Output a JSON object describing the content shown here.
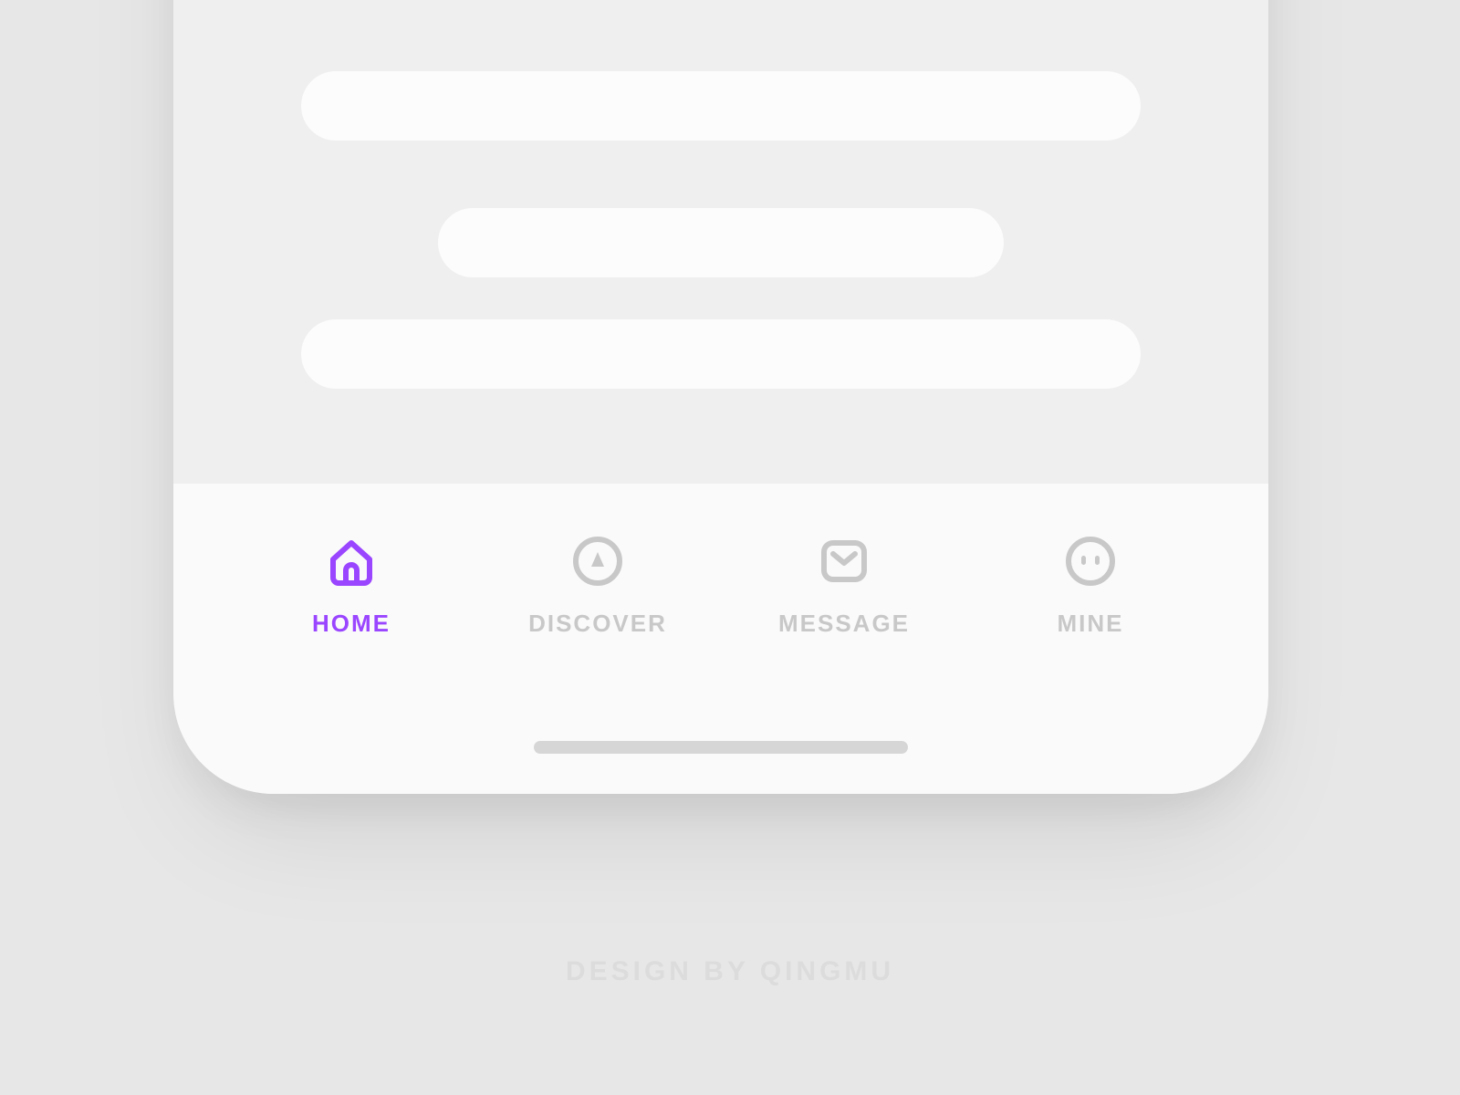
{
  "accent": "#9a45ff",
  "inactive": "#c8c8c8",
  "tabs": [
    {
      "label": "HOME",
      "icon": "home-icon",
      "active": true
    },
    {
      "label": "DISCOVER",
      "icon": "compass-icon",
      "active": false
    },
    {
      "label": "MESSAGE",
      "icon": "envelope-icon",
      "active": false
    },
    {
      "label": "MINE",
      "icon": "face-icon",
      "active": false
    }
  ],
  "credit": "DESIGN BY QINGMU"
}
